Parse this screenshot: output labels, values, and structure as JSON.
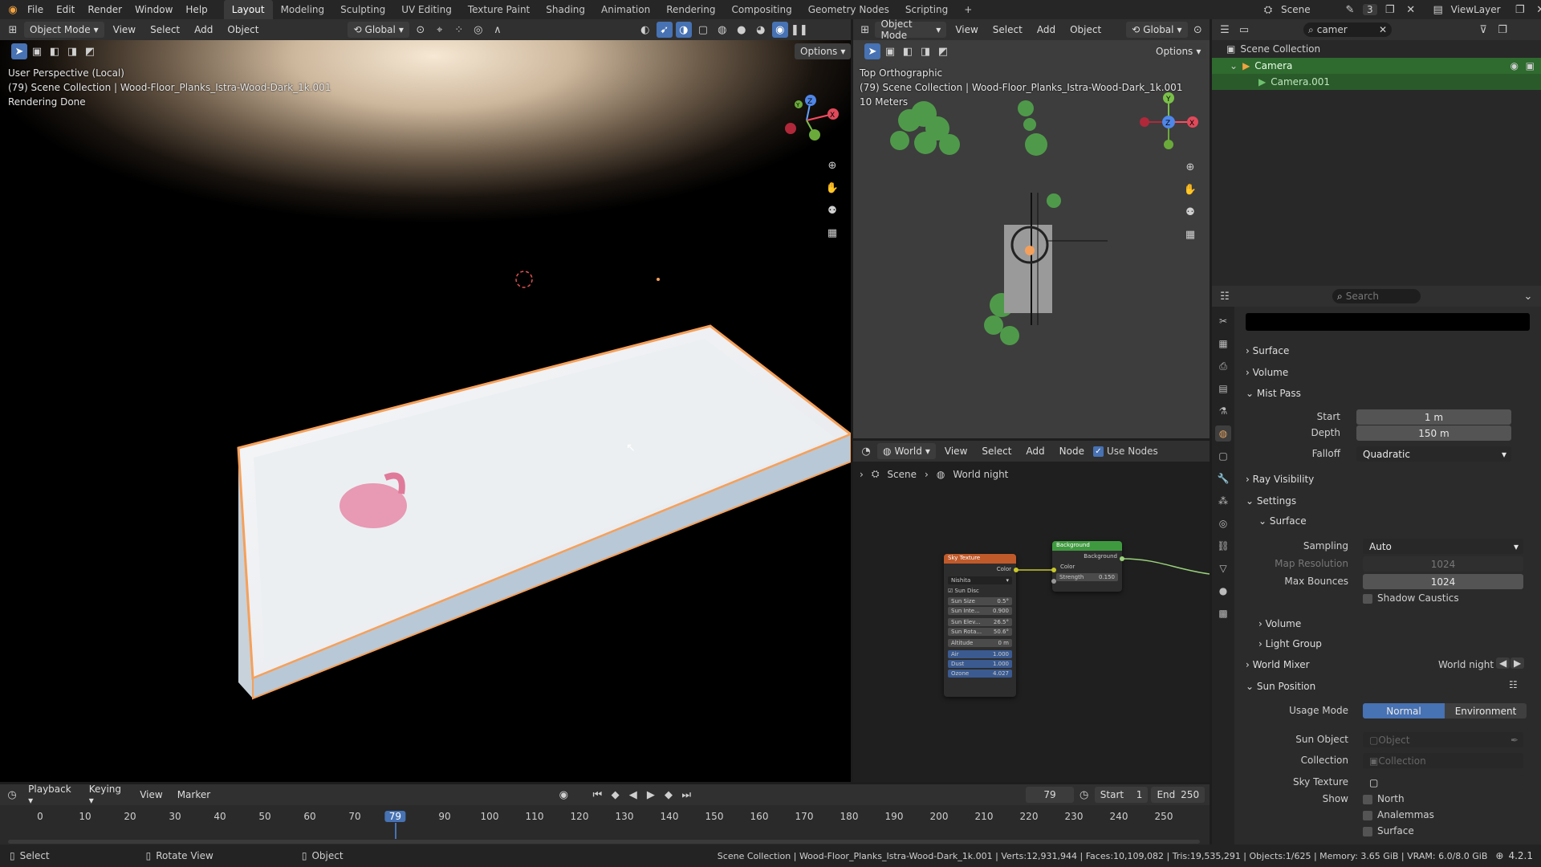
{
  "topbar": {
    "menus": [
      "File",
      "Edit",
      "Render",
      "Window",
      "Help"
    ],
    "workspaces": [
      "Layout",
      "Modeling",
      "Sculpting",
      "UV Editing",
      "Texture Paint",
      "Shading",
      "Animation",
      "Rendering",
      "Compositing",
      "Geometry Nodes",
      "Scripting"
    ],
    "active_workspace": "Layout",
    "scene": "Scene",
    "scene_count": "3",
    "view_layer": "ViewLayer"
  },
  "viewport_main": {
    "mode": "Object Mode",
    "menus": [
      "View",
      "Select",
      "Add",
      "Object"
    ],
    "transform": "Global",
    "options_label": "Options",
    "info_lines": [
      "User Perspective (Local)",
      "(79) Scene Collection | Wood-Floor_Planks_Istra-Wood-Dark_1k.001",
      "Rendering Done"
    ]
  },
  "viewport_top": {
    "mode": "Object Mode",
    "menus": [
      "View",
      "Select",
      "Add",
      "Object"
    ],
    "transform": "Global",
    "options_label": "Options",
    "info_lines": [
      "Top Orthographic",
      "(79) Scene Collection | Wood-Floor_Planks_Istra-Wood-Dark_1k.001",
      "10 Meters"
    ]
  },
  "node_editor": {
    "editor": "World",
    "menus": [
      "View",
      "Select",
      "Add",
      "Node"
    ],
    "use_nodes_label": "Use Nodes",
    "breadcrumb": [
      "Scene",
      "World night"
    ],
    "sky_node": {
      "title": "Sky Texture",
      "output": "Color",
      "type": "Nishita",
      "sun_disc": "Sun Disc",
      "fields": [
        {
          "label": "Sun Size",
          "value": "0.5°"
        },
        {
          "label": "Sun Inte...",
          "value": "0.900"
        },
        {
          "label": "Sun Elev...",
          "value": "26.5°"
        },
        {
          "label": "Sun Rota...",
          "value": "50.6°"
        },
        {
          "label": "Altitude",
          "value": "0 m"
        },
        {
          "label": "Air",
          "value": "1.000"
        },
        {
          "label": "Dust",
          "value": "1.000"
        },
        {
          "label": "Ozone",
          "value": "4.027"
        }
      ]
    },
    "bg_node": {
      "title": "Background",
      "output": "Background",
      "input": "Color",
      "strength_label": "Strength",
      "strength_value": "0.150"
    }
  },
  "outliner": {
    "search_value": "camer",
    "root": "Scene Collection",
    "items": [
      {
        "label": "Camera"
      },
      {
        "label": "Camera.001"
      }
    ]
  },
  "properties": {
    "search_placeholder": "Search",
    "sections": {
      "surface": "Surface",
      "volume": "Volume",
      "mist_pass": "Mist Pass",
      "ray_visibility": "Ray Visibility",
      "settings": "Settings",
      "settings_surface": "Surface",
      "settings_volume": "Volume",
      "light_group": "Light Group",
      "world_mixer": "World Mixer",
      "sun_position": "Sun Position"
    },
    "mist": {
      "start_label": "Start",
      "start_value": "1 m",
      "depth_label": "Depth",
      "depth_value": "150 m",
      "falloff_label": "Falloff",
      "falloff_value": "Quadratic"
    },
    "surface_settings": {
      "sampling_label": "Sampling",
      "sampling_value": "Auto",
      "map_res_label": "Map Resolution",
      "map_res_value": "1024",
      "max_bounces_label": "Max Bounces",
      "max_bounces_value": "1024",
      "shadow_caustics_label": "Shadow Caustics"
    },
    "world_mixer_value": "World night",
    "sun": {
      "usage_label": "Usage Mode",
      "usage_normal": "Normal",
      "usage_env": "Environment",
      "sun_object_label": "Sun Object",
      "sun_object_placeholder": "Object",
      "collection_label": "Collection",
      "collection_placeholder": "Collection",
      "sky_texture_label": "Sky Texture",
      "show_label": "Show",
      "show_options": [
        "North",
        "Analemmas",
        "Surface"
      ]
    }
  },
  "timeline": {
    "menus": [
      "Playback",
      "Keying",
      "View",
      "Marker"
    ],
    "current_frame": "79",
    "start_label": "Start",
    "start_value": "1",
    "end_label": "End",
    "end_value": "250",
    "ticks": [
      "0",
      "10",
      "20",
      "30",
      "40",
      "50",
      "60",
      "70",
      "79",
      "90",
      "100",
      "110",
      "120",
      "130",
      "140",
      "150",
      "160",
      "170",
      "180",
      "190",
      "200",
      "210",
      "220",
      "230",
      "240",
      "250"
    ]
  },
  "statusbar": {
    "left": [
      "Select",
      "Rotate View",
      "Object"
    ],
    "info": "Scene Collection | Wood-Floor_Planks_Istra-Wood-Dark_1k.001 | Verts:12,931,944 | Faces:10,109,082 | Tris:19,535,291 | Objects:1/625 | Memory: 3.65 GiB | VRAM: 6.0/8.0 GiB",
    "version": "4.2.1"
  },
  "colors": {
    "accent": "#4772b3",
    "selection_orange": "#f5a05a",
    "node_sky": "#c05a2a",
    "node_bg": "#3f9a3f",
    "outliner_highlight": "#2f6a2f"
  }
}
